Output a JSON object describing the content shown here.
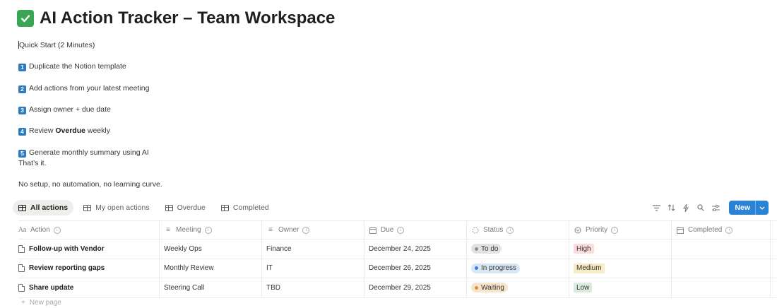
{
  "page": {
    "title": "AI Action Tracker – Team Workspace",
    "quick_start": "Quick Start (2 Minutes)",
    "steps": [
      {
        "num": "1",
        "text": "Duplicate the Notion template"
      },
      {
        "num": "2",
        "text": "Add actions from your latest meeting"
      },
      {
        "num": "3",
        "text": "Assign owner + due date"
      },
      {
        "num": "4",
        "pre": "Review ",
        "bold": "Overdue",
        "post": " weekly"
      },
      {
        "num": "5",
        "text": "Generate monthly summary using AI"
      }
    ],
    "thats_it": "That’s it.",
    "no_setup": "No setup, no automation, no learning curve."
  },
  "views": {
    "tabs": [
      "All actions",
      "My open actions",
      "Overdue",
      "Completed"
    ],
    "active_tab": "All actions",
    "new_button": "New"
  },
  "table": {
    "columns": [
      "Action",
      "Meeting",
      "Owner",
      "Due",
      "Status",
      "Priority",
      "Completed"
    ],
    "rows": [
      {
        "action": "Follow-up with Vendor",
        "meeting": "Weekly Ops",
        "owner": "Finance",
        "due": "December 24, 2025",
        "status": "To do",
        "priority": "High",
        "completed": ""
      },
      {
        "action": "Review reporting gaps",
        "meeting": "Monthly Review",
        "owner": "IT",
        "due": "December 26, 2025",
        "status": "In progress",
        "priority": "Medium",
        "completed": ""
      },
      {
        "action": "Share update",
        "meeting": "Steering Call",
        "owner": "TBD",
        "due": "December 29, 2025",
        "status": "Waiting",
        "priority": "Low",
        "completed": ""
      }
    ],
    "new_page": "New page"
  },
  "colors": {
    "accent_blue": "#2a83d4",
    "status_todo_bg": "#e3e2e0",
    "status_todo_dot": "#8d8c88",
    "status_inprogress_bg": "#d8e6f5",
    "status_inprogress_dot": "#3b7dd8",
    "status_waiting_bg": "#f7e4cc",
    "status_waiting_dot": "#d9903a",
    "priority_high_bg": "#fbdcdc",
    "priority_medium_bg": "#f8ecc6",
    "priority_low_bg": "#dcebe0"
  }
}
